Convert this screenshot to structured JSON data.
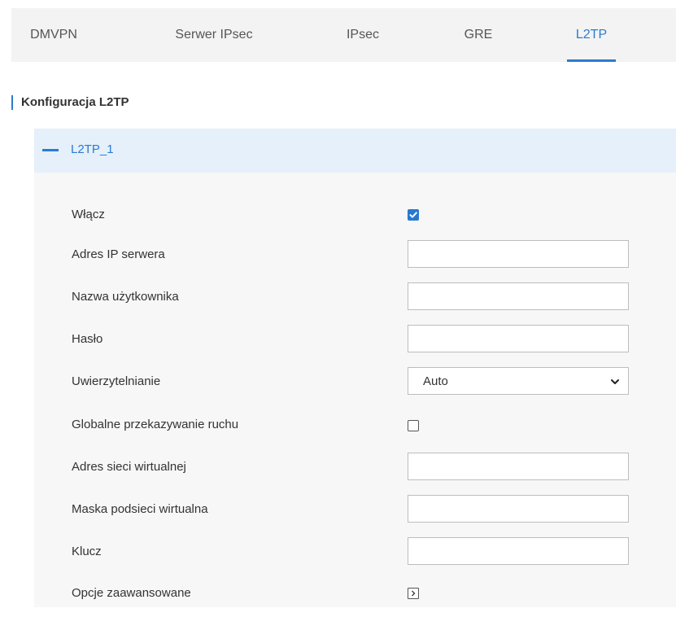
{
  "tabs": [
    {
      "label": "DMVPN",
      "active": false
    },
    {
      "label": "Serwer IPsec",
      "active": false
    },
    {
      "label": "IPsec",
      "active": false
    },
    {
      "label": "GRE",
      "active": false
    },
    {
      "label": "L2TP",
      "active": true
    }
  ],
  "section": {
    "title": "Konfiguracja L2TP"
  },
  "card": {
    "title": "L2TP_1",
    "fields": {
      "enable": {
        "label": "Włącz",
        "checked": true
      },
      "server_ip": {
        "label": "Adres IP serwera",
        "value": ""
      },
      "username": {
        "label": "Nazwa użytkownika",
        "value": ""
      },
      "password": {
        "label": "Hasło",
        "value": ""
      },
      "auth": {
        "label": "Uwierzytelnianie",
        "value": "Auto"
      },
      "global_forwarding": {
        "label": "Globalne przekazywanie ruchu",
        "checked": false
      },
      "virtual_network": {
        "label": "Adres sieci wirtualnej",
        "value": ""
      },
      "virtual_mask": {
        "label": "Maska podsieci wirtualna",
        "value": ""
      },
      "key": {
        "label": "Klucz",
        "value": ""
      },
      "advanced": {
        "label": "Opcje zaawansowane"
      }
    }
  },
  "colors": {
    "accent": "#2b7bd3",
    "tab_bar_bg": "#f3f3f3",
    "card_bg": "#f7f7f7",
    "card_header_bg": "#e5f0fa"
  }
}
